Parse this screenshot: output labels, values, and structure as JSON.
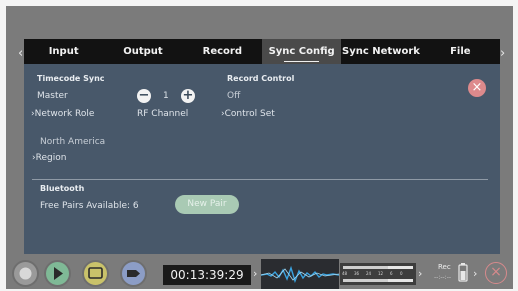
{
  "tabs": [
    {
      "label": "Input"
    },
    {
      "label": "Output"
    },
    {
      "label": "Record"
    },
    {
      "label": "Sync Config",
      "active": true
    },
    {
      "label": "Sync Network"
    },
    {
      "label": "File"
    }
  ],
  "timecode_sync": {
    "title": "Timecode Sync",
    "value": "Master",
    "link_label": "Network Role"
  },
  "rf_channel": {
    "minus_symbol": "−",
    "value": "1",
    "plus_symbol": "+",
    "label": "RF Channel"
  },
  "record_control": {
    "title": "Record Control",
    "value": "Off",
    "link_label": "Control Set"
  },
  "region": {
    "value": "North America",
    "link_label": "Region"
  },
  "bluetooth": {
    "title": "Bluetooth",
    "pairs_text": "Free Pairs Available: 6",
    "new_pair_label": "New Pair"
  },
  "close_symbol": "×",
  "chevron_symbol": "›",
  "bottom_bar": {
    "timecode": "00:13:39:29",
    "rec_label": "Rec",
    "rec_sub": "--:--:--",
    "meter_ticks": [
      "48",
      "36",
      "24",
      "12",
      "6",
      "0"
    ]
  },
  "colors": {
    "panel": "#48586a",
    "tab_bar": "#121212",
    "close_button": "#dd8a8c",
    "new_pair_button": "#a9cab4",
    "play_button": "#7fb996",
    "monitor_button": "#c9c26a",
    "tag_button": "#8c9dc6"
  }
}
